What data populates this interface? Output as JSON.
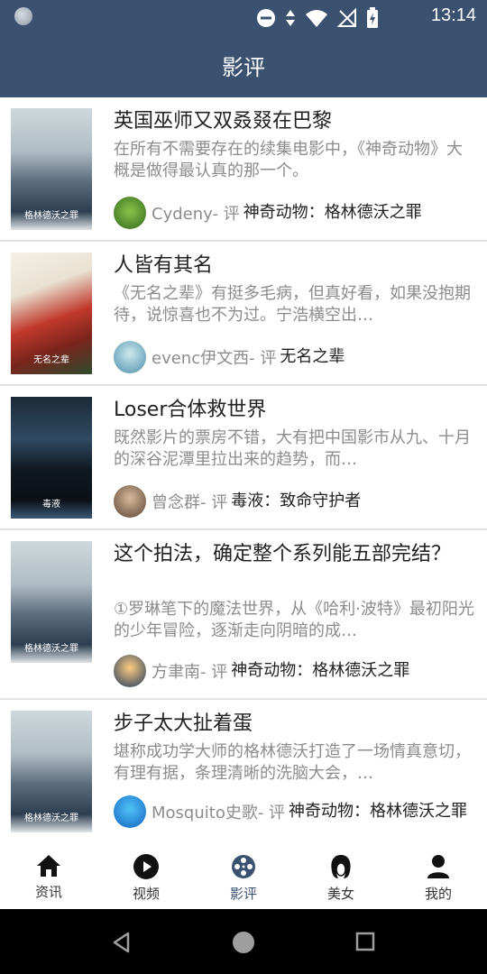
{
  "status": {
    "time": "13:14"
  },
  "appbar": {
    "title": "影评"
  },
  "reviews": [
    {
      "title": "英国巫师又双叒叕在巴黎",
      "summary": "在所有不需要存在的续集电影中，《神奇动物》大概是做得最认真的那一个。",
      "author": "Cydeny- 评",
      "movie": "神奇动物：格林德沃之罪",
      "poster_caption": "格林德沃之罪"
    },
    {
      "title": "人皆有其名",
      "summary": "《无名之辈》有挺多毛病，但真好看，如果没抱期待，说惊喜也不为过。宁浩横空出…",
      "author": "evenc伊文西- 评",
      "movie": "无名之辈",
      "poster_caption": "无名之辈"
    },
    {
      "title": "Loser合体救世界",
      "summary": "既然影片的票房不错，大有把中国影市从九、十月的深谷泥潭里拉出来的趋势，而…",
      "author": "曾念群- 评",
      "movie": "毒液：致命守护者",
      "poster_caption": "毒液"
    },
    {
      "title": "这个拍法，确定整个系列能五部完结？",
      "summary": "①罗琳笔下的魔法世界，从《哈利·波特》最初阳光的少年冒险，逐渐走向阴暗的成…",
      "author": "方聿南- 评",
      "movie": "神奇动物：格林德沃之罪",
      "poster_caption": "格林德沃之罪"
    },
    {
      "title": "步子太大扯着蛋",
      "summary": "堪称成功学大师的格林德沃打造了一场情真意切，有理有据，条理清晰的洗脑大会，…",
      "author": "Mosquito史歌- 评",
      "movie": "神奇动物：格林德沃之罪",
      "poster_caption": "格林德沃之罪"
    }
  ],
  "tabs": [
    {
      "label": "资讯",
      "icon": "home-icon"
    },
    {
      "label": "视频",
      "icon": "play-icon"
    },
    {
      "label": "影评",
      "icon": "film-reel-icon"
    },
    {
      "label": "美女",
      "icon": "woman-face-icon"
    },
    {
      "label": "我的",
      "icon": "person-icon"
    }
  ],
  "active_tab": "影评",
  "colors": {
    "primary": "#3b5170",
    "summary": "#8c8c8c",
    "divider": "#e2e2e2"
  }
}
